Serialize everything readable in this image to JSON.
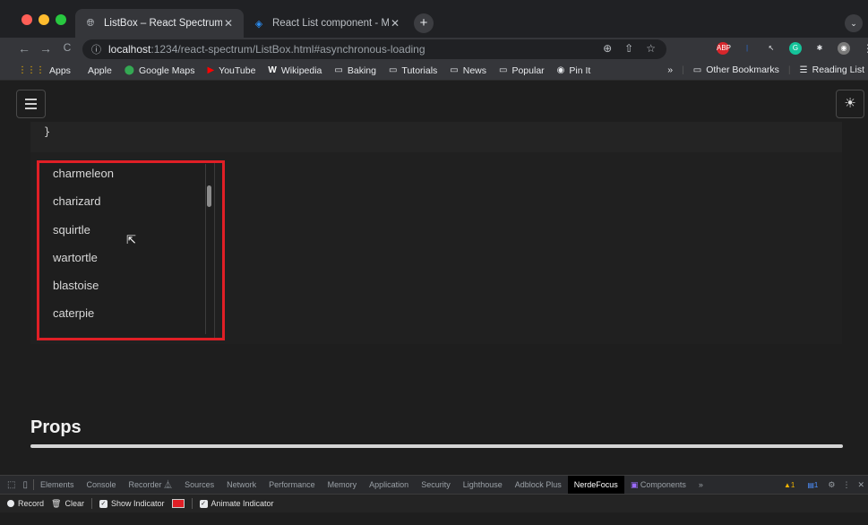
{
  "browser": {
    "tabs": [
      {
        "title": "ListBox – React Spectrum",
        "favicon": "globe-icon",
        "close": "✕",
        "active": true
      },
      {
        "title": "React List component - MUI",
        "favicon": "mui-icon",
        "close": "✕",
        "active": false
      }
    ],
    "new_tab": "+",
    "tab_search": "⌄",
    "nav": {
      "back": "←",
      "forward": "→",
      "reload": "C"
    },
    "url": {
      "host": "localhost",
      "rest": ":1234/react-spectrum/ListBox.html#asynchronous-loading"
    },
    "omnibox_icons": [
      "zoom-icon",
      "share-icon",
      "star-icon"
    ],
    "extensions": [
      {
        "name": "adblock-icon",
        "label": "ABP",
        "color": "#d7262b"
      },
      {
        "name": "bars-extension-icon",
        "label": "|",
        "color": "#2b6fd6"
      },
      {
        "name": "cursor-extension-icon",
        "label": "↖",
        "color": "#35363a"
      },
      {
        "name": "grammarly-icon",
        "label": "G",
        "color": "#15c39a"
      },
      {
        "name": "puzzle-icon",
        "label": "✱",
        "color": "#35363a"
      },
      {
        "name": "profile-avatar-icon",
        "label": "◉",
        "color": "#7a7a7a"
      }
    ],
    "menu": "⋮"
  },
  "bookmarks": {
    "items": [
      {
        "label": "Apps",
        "icon": "apps-grid-icon",
        "glyph": "⋮⋮⋮",
        "color": "#f4b400"
      },
      {
        "label": "Apple",
        "icon": "apple-icon",
        "glyph": "",
        "color": "#cccccc"
      },
      {
        "label": "Google Maps",
        "icon": "maps-pin-icon",
        "glyph": "⬤",
        "color": "#34a853"
      },
      {
        "label": "YouTube",
        "icon": "youtube-icon",
        "glyph": "▶",
        "color": "#ff0000"
      },
      {
        "label": "Wikipedia",
        "icon": "wikipedia-icon",
        "glyph": "W",
        "color": "#ffffff"
      },
      {
        "label": "Baking",
        "icon": "folder-icon",
        "glyph": "▭",
        "color": "#e8eaed"
      },
      {
        "label": "Tutorials",
        "icon": "folder-icon",
        "glyph": "▭",
        "color": "#e8eaed"
      },
      {
        "label": "News",
        "icon": "folder-icon",
        "glyph": "▭",
        "color": "#e8eaed"
      },
      {
        "label": "Popular",
        "icon": "folder-icon",
        "glyph": "▭",
        "color": "#e8eaed"
      },
      {
        "label": "Pin It",
        "icon": "pinterest-icon",
        "glyph": "◉",
        "color": "#e8eaed"
      }
    ],
    "overflow": "»",
    "other": "Other Bookmarks",
    "reading_list": "Reading List"
  },
  "page": {
    "menu_button": "hamburger-menu",
    "theme_toggle": "☀",
    "code_closing": "}",
    "listbox_items": [
      "charmeleon",
      "charizard",
      "squirtle",
      "wartortle",
      "blastoise",
      "caterpie"
    ],
    "props_heading": "Props"
  },
  "devtools": {
    "tabs": [
      "Elements",
      "Console",
      "Recorder ⏅",
      "Sources",
      "Network",
      "Performance",
      "Memory",
      "Application",
      "Security",
      "Lighthouse",
      "Adblock Plus",
      "NerdeFocus",
      "Components",
      "»"
    ],
    "active_tab": "NerdeFocus",
    "warnings": "▲1",
    "messages": "▤1",
    "toolbar": {
      "record": "Record",
      "clear": "Clear",
      "show_indicator": "Show Indicator",
      "animate_indicator": "Animate Indicator",
      "indicator_color": "#e01f26"
    }
  },
  "colors": {
    "highlight_border": "#e01f26",
    "page_background": "#1e1e1e"
  }
}
